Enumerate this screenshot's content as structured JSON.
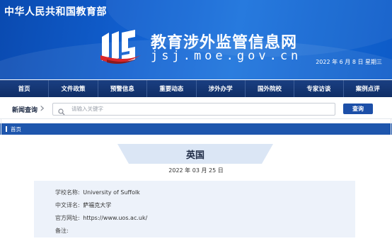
{
  "header": {
    "ministry": "中华人民共和国教育部",
    "site_title": "教育涉外监管信息网",
    "domain": "jsj.moe.gov.cn",
    "date": "2022 年 6 月 8 日 星期三"
  },
  "nav": {
    "items": [
      {
        "label": "首页"
      },
      {
        "label": "文件政策"
      },
      {
        "label": "预警信息"
      },
      {
        "label": "重要动态"
      },
      {
        "label": "涉外办学"
      },
      {
        "label": "国外院校"
      },
      {
        "label": "专家访谈"
      },
      {
        "label": "案例点评"
      }
    ]
  },
  "search": {
    "label": "新闻查询",
    "placeholder": "请输入关键字",
    "value": "",
    "button": "查询"
  },
  "breadcrumb": {
    "label": "首页"
  },
  "article": {
    "title": "英国",
    "date": "2022 年 03 月 25 日",
    "fields": [
      {
        "label": "学校名称:",
        "value": "University of Suffolk"
      },
      {
        "label": "中文译名:",
        "value": "萨福克大学"
      },
      {
        "label": "官方网址:",
        "value": "https://www.uos.ac.uk/"
      },
      {
        "label": "备注:",
        "value": ""
      }
    ]
  },
  "colors": {
    "banner_blue": "#1160d0",
    "nav_navy": "#102e66",
    "logo_red": "#d9262b",
    "button_blue": "#1c4fa8",
    "info_box": "#edf2fa"
  },
  "icons": {
    "logo": "js-logo-icon",
    "chevron": "chevron-right-icon",
    "search": "search-icon"
  }
}
